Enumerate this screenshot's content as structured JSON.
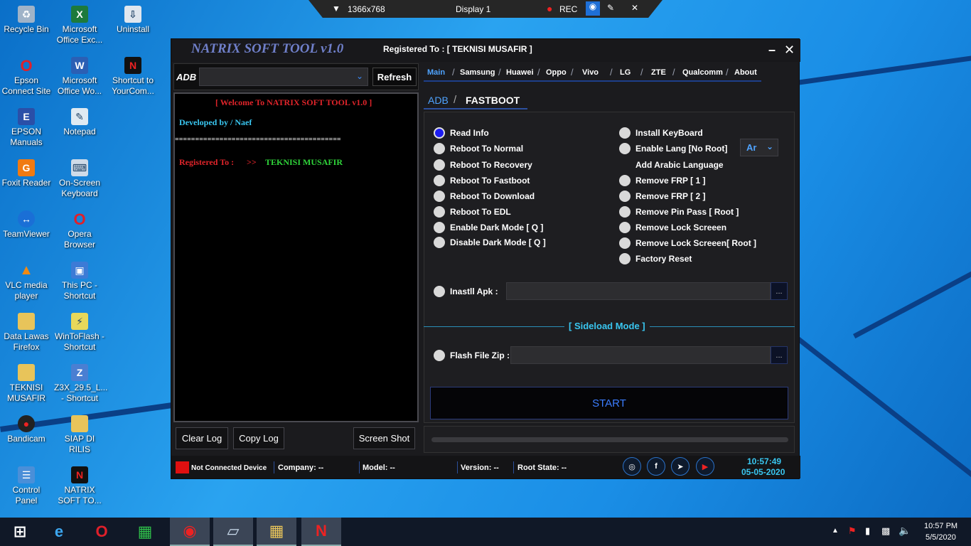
{
  "recorder": {
    "resolution": "1366x768",
    "display": "Display 1",
    "rec_label": "REC"
  },
  "desktop_icons": [
    {
      "label": "Recycle Bin",
      "icon": "recycle-bin-icon"
    },
    {
      "label": "Microsoft Office Exc...",
      "icon": "excel-icon"
    },
    {
      "label": "Uninstall",
      "icon": "uninstall-icon"
    },
    {
      "label": "Epson Connect Site",
      "icon": "opera-icon"
    },
    {
      "label": "Microsoft Office Wo...",
      "icon": "word-icon"
    },
    {
      "label": "Shortcut to YourCom...",
      "icon": "nk-icon"
    },
    {
      "label": "EPSON Manuals",
      "icon": "epson-icon"
    },
    {
      "label": "Notepad",
      "icon": "notepad-icon"
    },
    {
      "label": "Foxit Reader",
      "icon": "foxit-icon"
    },
    {
      "label": "On-Screen Keyboard",
      "icon": "keyboard-icon"
    },
    {
      "label": "TeamViewer",
      "icon": "teamviewer-icon"
    },
    {
      "label": "Opera Browser",
      "icon": "opera-icon"
    },
    {
      "label": "VLC media player",
      "icon": "vlc-icon"
    },
    {
      "label": "This PC - Shortcut",
      "icon": "computer-icon"
    },
    {
      "label": "Data Lawas Firefox",
      "icon": "folder-icon"
    },
    {
      "label": "WinToFlash - Shortcut",
      "icon": "wintoflash-icon"
    },
    {
      "label": "TEKNISI MUSAFIR",
      "icon": "folder-icon"
    },
    {
      "label": "Z3X_29.5_L... - Shortcut",
      "icon": "z3x-icon"
    },
    {
      "label": "Bandicam",
      "icon": "bandicam-icon"
    },
    {
      "label": "SIAP DI RILIS",
      "icon": "folder-icon"
    },
    {
      "label": "Control Panel",
      "icon": "control-panel-icon"
    },
    {
      "label": "NATRIX SOFT TO...",
      "icon": "nk-icon"
    }
  ],
  "app": {
    "title": "NATRIX SOFT TOOL v1.0",
    "registered": "Registered To : [ TEKNISI MUSAFIR ]",
    "minimize": "–",
    "close": "✕",
    "adb_label": "ADB",
    "port_value": "",
    "refresh": "Refresh",
    "log": {
      "welcome": "[ Welcome To NATRIX SOFT TOOL v1.0 ]",
      "developed": "Developed by /  Naef",
      "divider": "=========================================",
      "registered_label": "Registered To :",
      "arrow": ">>",
      "registered_name": "TEKNISI MUSAFIR"
    },
    "buttons": {
      "clear_log": "Clear Log",
      "copy_log": "Copy Log",
      "screen_shot": "Screen Shot"
    },
    "tabs": [
      "Main",
      "Samsung",
      "Huawei",
      "Oppo",
      "Vivo",
      "LG",
      "ZTE",
      "Qualcomm",
      "About"
    ],
    "subtabs": {
      "adb": "ADB",
      "slash": "/",
      "fastboot": "FASTBOOT"
    },
    "left_options": [
      "Read Info",
      "Reboot To Normal",
      "Reboot To Recovery",
      "Reboot To Fastboot",
      "Reboot To Download",
      "Reboot To EDL",
      "Enable Dark Mode [ Q ]",
      "Disable Dark Mode [ Q ]"
    ],
    "right_options": [
      "Install KeyBoard",
      "Enable Lang [No Root]",
      "Add Arabic Language",
      "Remove FRP [ 1 ]",
      "Remove FRP [ 2 ]",
      "Remove Pin Pass [ Root ]",
      "Remove Lock Screeen",
      "Remove Lock Screeen[ Root ]",
      "Factory Reset"
    ],
    "lang_value": "Ar",
    "install_apk": "Inastll Apk :",
    "browse": "...",
    "sideload": "[ Sideload Mode ]",
    "flash_zip": "Flash File Zip :",
    "start": "START",
    "progress": 0,
    "status": {
      "device": "Not Connected Device",
      "company": "Company: --",
      "model": "Model: --",
      "version": "Version: --",
      "root": "Root State: --",
      "time": "10:57:49",
      "date": "05-05-2020"
    },
    "social": [
      {
        "icon": "dribbble-icon",
        "glyph": "◎"
      },
      {
        "icon": "facebook-icon",
        "glyph": "f"
      },
      {
        "icon": "telegram-icon",
        "glyph": "➤"
      },
      {
        "icon": "youtube-icon",
        "glyph": "▶"
      }
    ]
  },
  "taskbar": {
    "time": "10:57 PM",
    "date": "5/5/2020",
    "apps": [
      "start-icon",
      "ie-icon",
      "opera-icon",
      "store-icon",
      "bandicam-icon",
      "explorer-icon",
      "folder-icon",
      "nk-icon"
    ]
  },
  "colors": {
    "accent": "#3b7dff",
    "log_red": "#e0242a",
    "log_cyan": "#39c6f0",
    "log_green": "#2fd43a"
  }
}
